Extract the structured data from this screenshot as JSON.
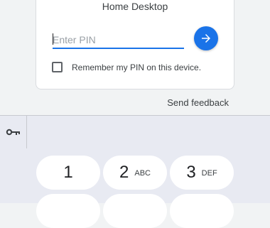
{
  "dialog": {
    "title": "Home Desktop",
    "pin_placeholder": "Enter PIN",
    "pin_value": "",
    "remember_label": "Remember my PIN on this device.",
    "remember_checked": false
  },
  "feedback_label": "Send feedback",
  "keyboard": {
    "keys": [
      {
        "digit": "1",
        "letters": ""
      },
      {
        "digit": "2",
        "letters": "ABC"
      },
      {
        "digit": "3",
        "letters": "DEF"
      }
    ]
  },
  "colors": {
    "accent": "#1a73e8",
    "keyboard_bg": "#e8eaf2"
  }
}
